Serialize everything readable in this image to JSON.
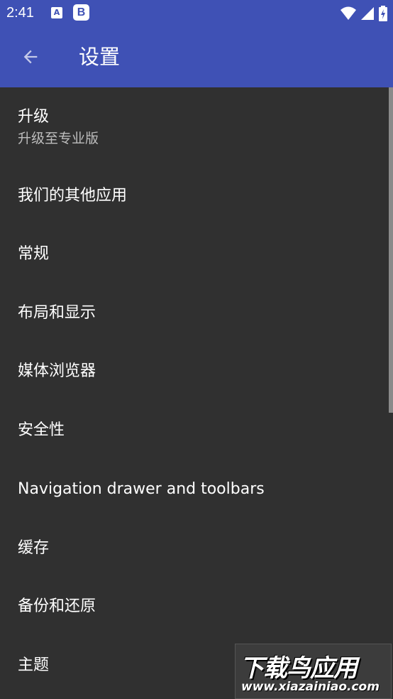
{
  "status_bar": {
    "time": "2:41",
    "notif_a": "A",
    "notif_b": "B",
    "wifi_icon": "wifi-icon",
    "signal_icon": "signal-icon",
    "battery_icon": "battery-charging-icon"
  },
  "app_bar": {
    "title": "设置",
    "back_icon": "arrow-back-icon",
    "color": "#3f51b5"
  },
  "settings": {
    "items": [
      {
        "label": "升级",
        "subtitle": "升级至专业版"
      },
      {
        "label": "我们的其他应用"
      },
      {
        "label": "常规"
      },
      {
        "label": "布局和显示"
      },
      {
        "label": "媒体浏览器"
      },
      {
        "label": "安全性"
      },
      {
        "label": "Navigation drawer and toolbars"
      },
      {
        "label": "缓存"
      },
      {
        "label": "备份和还原"
      },
      {
        "label": "主题"
      }
    ]
  },
  "watermark": {
    "title": "下载鸟应用",
    "url": "www.xiazainiao.com"
  }
}
